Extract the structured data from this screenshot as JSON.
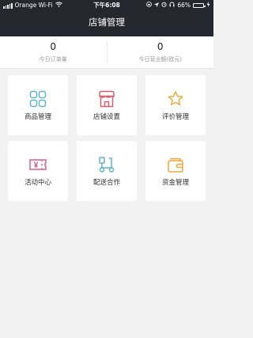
{
  "status_bar": {
    "carrier": "Orange Wi-Fi",
    "time": "下午6:08",
    "battery": "66%",
    "battery_level": 0.66
  },
  "header": {
    "title": "店铺管理"
  },
  "stats": [
    {
      "value": "0",
      "label": "今日订单量"
    },
    {
      "value": "0",
      "label": "今日营业额(欧元)"
    }
  ],
  "menu": [
    {
      "label": "商品管理",
      "icon": "goods-grid-icon",
      "color": "#5fb3c9"
    },
    {
      "label": "店铺设置",
      "icon": "store-icon",
      "color": "#e05b6a"
    },
    {
      "label": "评价管理",
      "icon": "star-icon",
      "color": "#f2a83a"
    },
    {
      "label": "活动中心",
      "icon": "coupon-yen-icon",
      "color": "#e05b8a"
    },
    {
      "label": "配送合作",
      "icon": "scooter-icon",
      "color": "#5fb3c9"
    },
    {
      "label": "资金管理",
      "icon": "wallet-icon",
      "color": "#f2a83a"
    }
  ]
}
